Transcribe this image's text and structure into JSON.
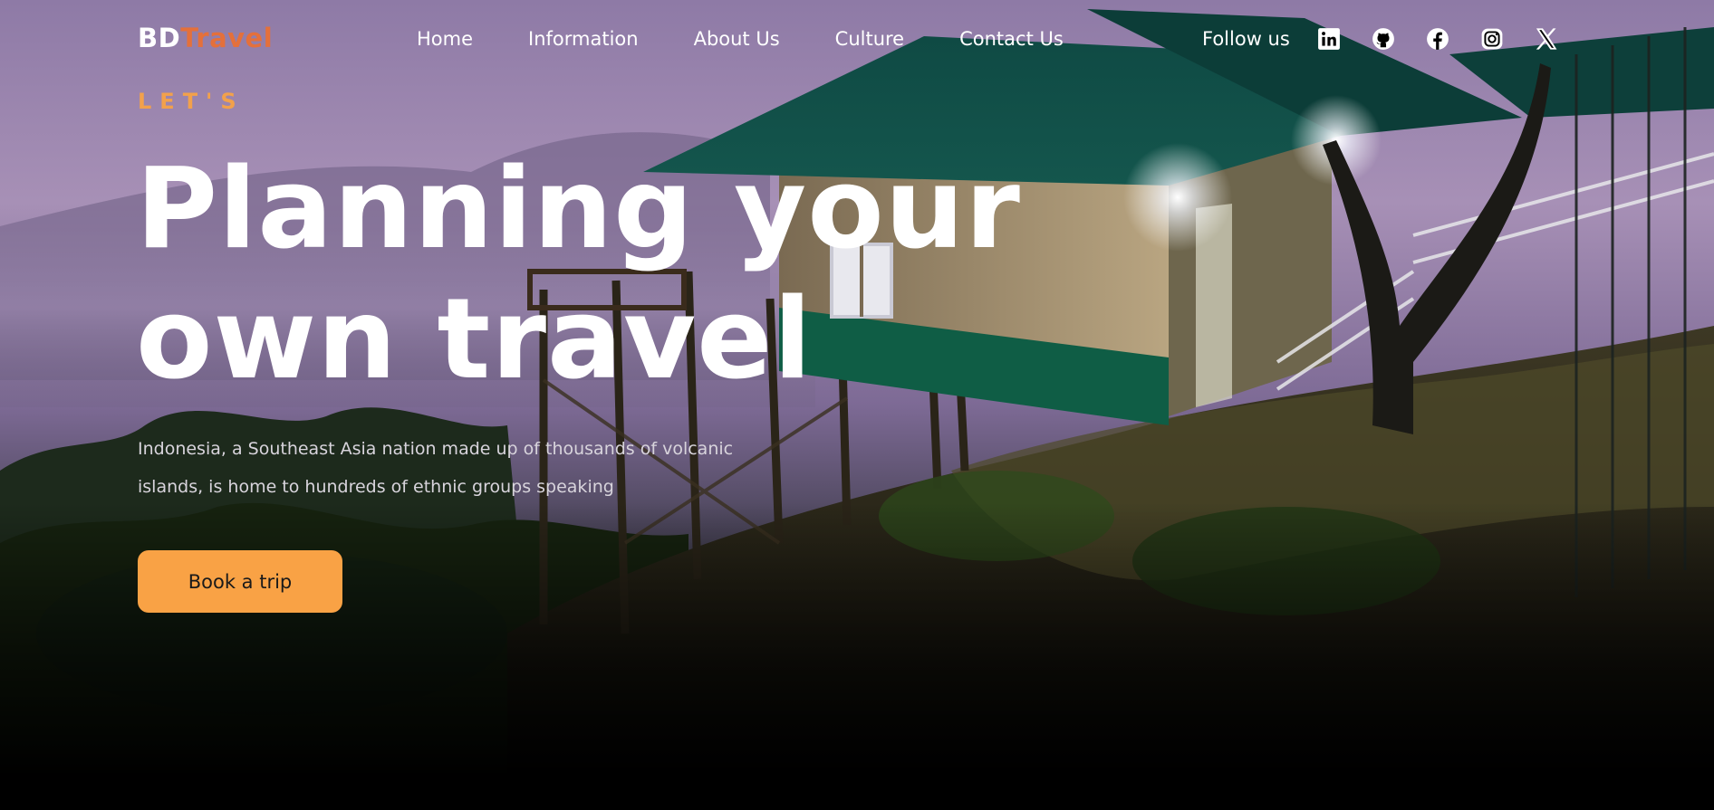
{
  "brand": {
    "prefix": "BD",
    "suffix": "Travel",
    "prefix_color": "#ffffff",
    "suffix_color": "#e4703b"
  },
  "nav": {
    "items": [
      {
        "label": "Home"
      },
      {
        "label": "Information"
      },
      {
        "label": "About Us"
      },
      {
        "label": "Culture"
      },
      {
        "label": "Contact Us"
      }
    ],
    "follow_label": "Follow us",
    "socials": [
      {
        "icon": "linkedin-icon"
      },
      {
        "icon": "github-icon"
      },
      {
        "icon": "facebook-icon"
      },
      {
        "icon": "instagram-icon"
      },
      {
        "icon": "x-icon"
      }
    ]
  },
  "hero": {
    "eyebrow": "LET'S",
    "headline_line1": "Planning your",
    "headline_line2": "own travel",
    "description": "Indonesia, a Southeast Asia nation made up of thousands of volcanic islands, is home to hundreds of ethnic groups speaking",
    "cta_label": "Book a trip",
    "accent_color": "#f9a245",
    "eyebrow_color": "#f2a14b"
  }
}
